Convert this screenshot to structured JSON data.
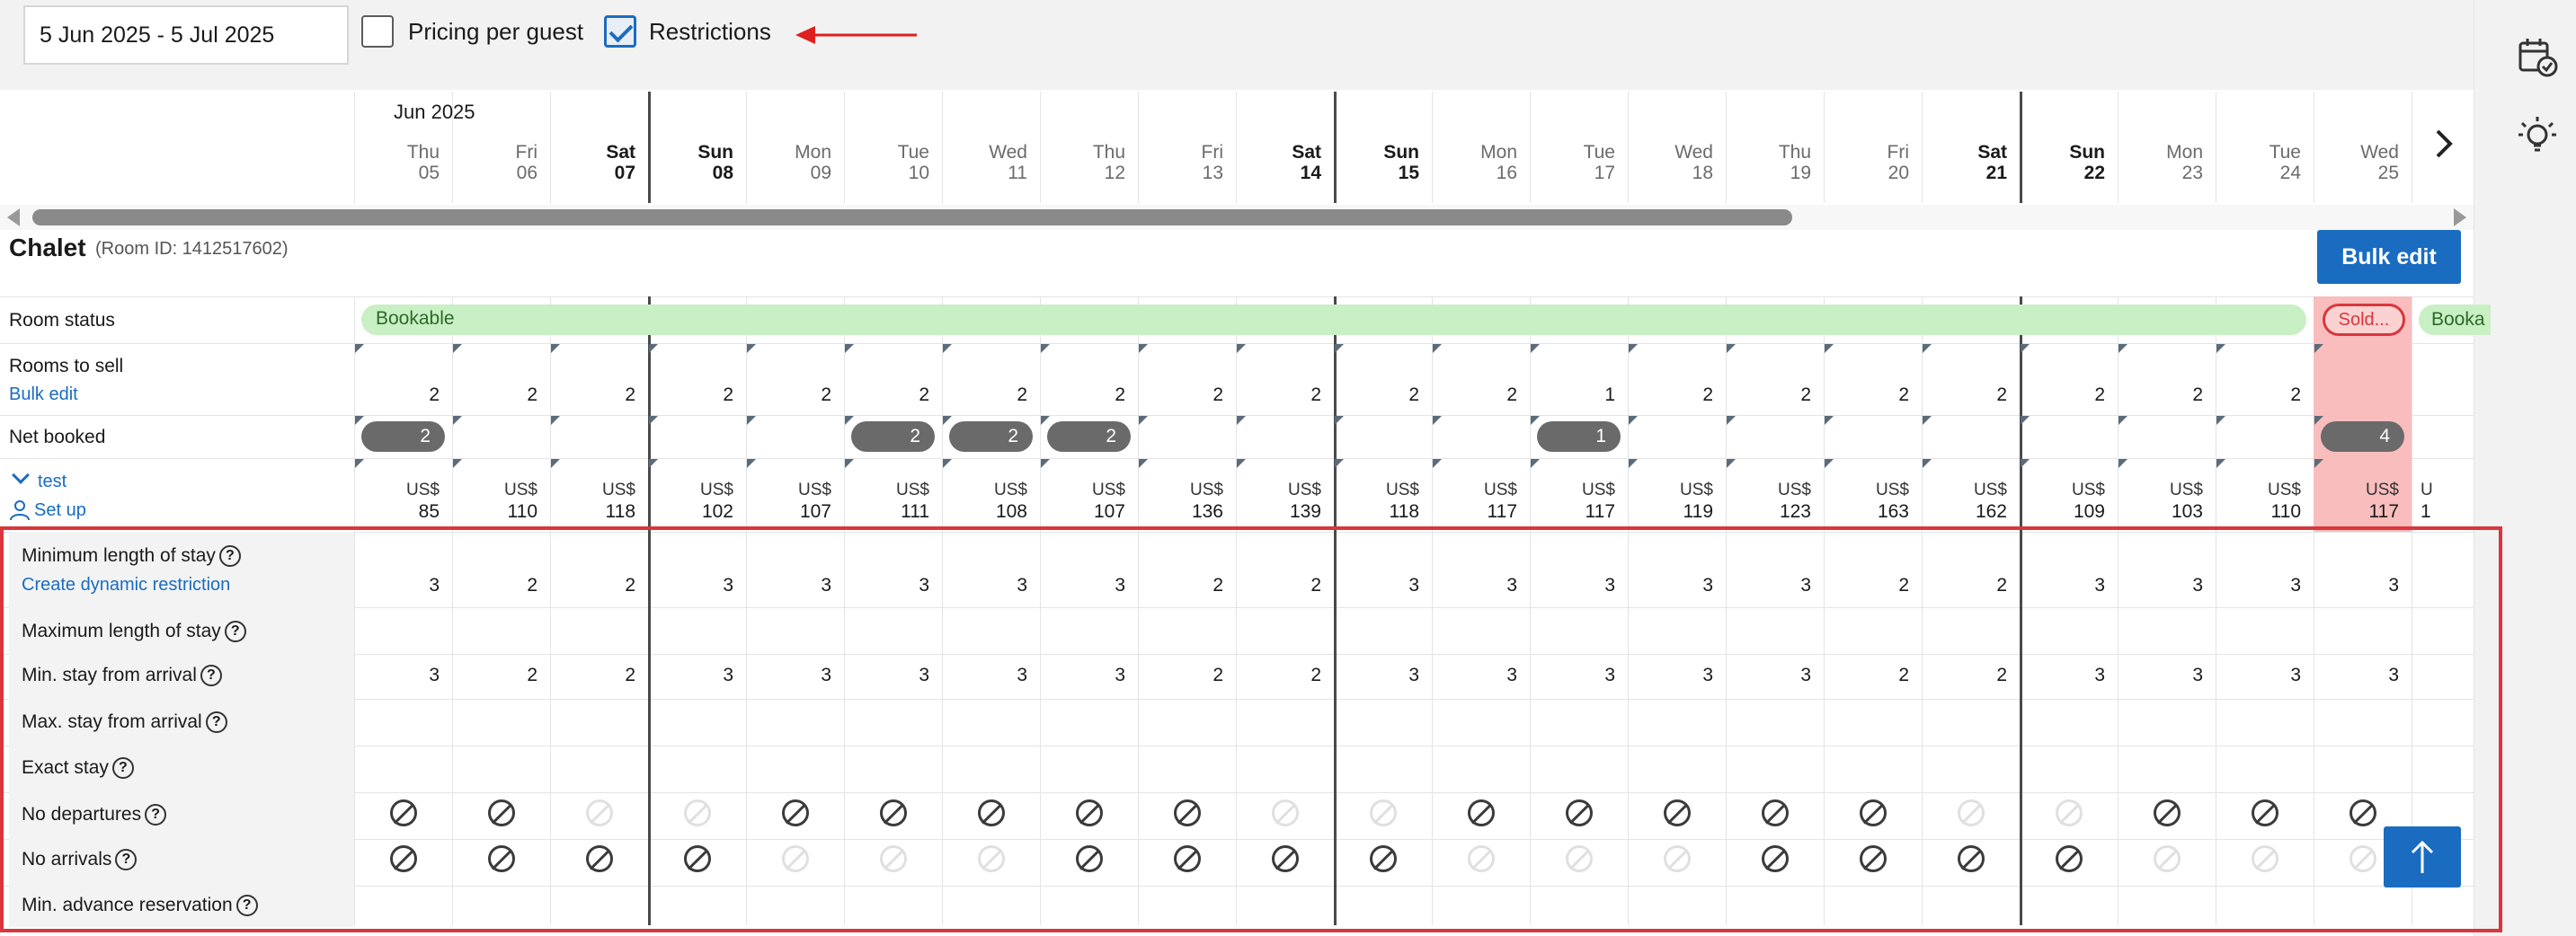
{
  "toolbar": {
    "date_range": "5 Jun 2025 - 5 Jul 2025",
    "pricing_per_guest_label": "Pricing per guest",
    "pricing_per_guest_checked": false,
    "restrictions_label": "Restrictions",
    "restrictions_checked": true
  },
  "calendar": {
    "month_label": "Jun 2025",
    "days": [
      {
        "dow": "Thu",
        "num": "05",
        "weekend": false
      },
      {
        "dow": "Fri",
        "num": "06",
        "weekend": false
      },
      {
        "dow": "Sat",
        "num": "07",
        "weekend": true
      },
      {
        "dow": "Sun",
        "num": "08",
        "weekend": true
      },
      {
        "dow": "Mon",
        "num": "09",
        "weekend": false
      },
      {
        "dow": "Tue",
        "num": "10",
        "weekend": false
      },
      {
        "dow": "Wed",
        "num": "11",
        "weekend": false
      },
      {
        "dow": "Thu",
        "num": "12",
        "weekend": false
      },
      {
        "dow": "Fri",
        "num": "13",
        "weekend": false
      },
      {
        "dow": "Sat",
        "num": "14",
        "weekend": true
      },
      {
        "dow": "Sun",
        "num": "15",
        "weekend": true
      },
      {
        "dow": "Mon",
        "num": "16",
        "weekend": false
      },
      {
        "dow": "Tue",
        "num": "17",
        "weekend": false
      },
      {
        "dow": "Wed",
        "num": "18",
        "weekend": false
      },
      {
        "dow": "Thu",
        "num": "19",
        "weekend": false
      },
      {
        "dow": "Fri",
        "num": "20",
        "weekend": false
      },
      {
        "dow": "Sat",
        "num": "21",
        "weekend": true
      },
      {
        "dow": "Sun",
        "num": "22",
        "weekend": true
      },
      {
        "dow": "Mon",
        "num": "23",
        "weekend": false
      },
      {
        "dow": "Tue",
        "num": "24",
        "weekend": false
      },
      {
        "dow": "Wed",
        "num": "25",
        "weekend": false
      }
    ]
  },
  "room": {
    "name": "Chalet",
    "room_id": "(Room ID: 1412517602)",
    "bulk_edit_button": "Bulk edit"
  },
  "rows": {
    "room_status_label": "Room status",
    "bookable_label": "Bookable",
    "sold_label": "Sold...",
    "bookable_after_label": "Booka",
    "rooms_to_sell_label": "Rooms to sell",
    "rooms_to_sell_link": "Bulk edit",
    "rooms_to_sell": [
      "2",
      "2",
      "2",
      "2",
      "2",
      "2",
      "2",
      "2",
      "2",
      "2",
      "2",
      "2",
      "1",
      "2",
      "2",
      "2",
      "2",
      "2",
      "2",
      "2",
      ""
    ],
    "net_booked_label": "Net booked",
    "net_booked_pills": [
      {
        "start": 0,
        "span": 1,
        "value": "2"
      },
      {
        "start": 5,
        "span": 1,
        "value": "2"
      },
      {
        "start": 6,
        "span": 1,
        "value": "2"
      },
      {
        "start": 7,
        "span": 1,
        "value": "2"
      },
      {
        "start": 12,
        "span": 1,
        "value": "1"
      },
      {
        "start": 20,
        "span": 1,
        "value": "4"
      }
    ],
    "rate_name": "test",
    "rate_setup_link": "Set up",
    "currency": "US$",
    "prices": [
      "85",
      "110",
      "118",
      "102",
      "107",
      "111",
      "108",
      "107",
      "136",
      "139",
      "118",
      "117",
      "117",
      "119",
      "123",
      "163",
      "162",
      "109",
      "103",
      "110",
      "117"
    ],
    "partial_col_price": "1",
    "partial_col_currency": "U"
  },
  "restrictions": {
    "min_los_label": "Minimum length of stay",
    "dynamic_link": "Create dynamic restriction",
    "min_los": [
      "3",
      "2",
      "2",
      "3",
      "3",
      "3",
      "3",
      "3",
      "2",
      "2",
      "3",
      "3",
      "3",
      "3",
      "3",
      "2",
      "2",
      "3",
      "3",
      "3",
      "3"
    ],
    "max_los_label": "Maximum length of stay",
    "min_stay_arrival_label": "Min. stay from arrival",
    "min_stay_arrival": [
      "3",
      "2",
      "2",
      "3",
      "3",
      "3",
      "3",
      "3",
      "2",
      "2",
      "3",
      "3",
      "3",
      "3",
      "3",
      "2",
      "2",
      "3",
      "3",
      "3",
      "3"
    ],
    "max_stay_arrival_label": "Max. stay from arrival",
    "exact_stay_label": "Exact stay",
    "no_departures_label": "No departures",
    "no_departures": [
      1,
      1,
      0,
      0,
      1,
      1,
      1,
      1,
      1,
      0,
      0,
      1,
      1,
      1,
      1,
      1,
      0,
      0,
      1,
      1,
      1,
      1
    ],
    "no_arrivals_label": "No arrivals",
    "no_arrivals": [
      1,
      1,
      1,
      1,
      0,
      0,
      0,
      1,
      1,
      1,
      1,
      0,
      0,
      0,
      1,
      1,
      1,
      1,
      0,
      0,
      0,
      1
    ],
    "min_advance_label": "Min. advance reservation"
  },
  "icons": {
    "calendar_check": "calendar-check-icon",
    "lightbulb": "lightbulb-icon",
    "chevron_right": "chevron-right-icon",
    "scroll_top": "arrow-up-icon"
  },
  "colors": {
    "accent": "#1a6cc1",
    "bookable_bg": "#c9efc5",
    "sold_bg": "#f9bdbd",
    "highlight_border": "#d9363e",
    "arrow": "#e02020"
  }
}
